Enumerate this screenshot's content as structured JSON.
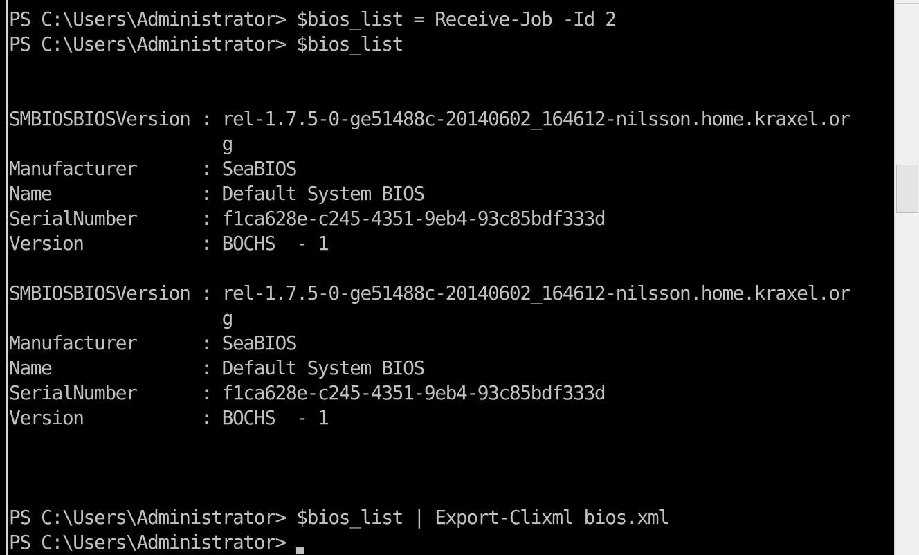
{
  "terminal": {
    "lines": [
      "PS C:\\Users\\Administrator> $bios_list = Receive-Job -Id 2",
      "PS C:\\Users\\Administrator> $bios_list",
      "",
      "",
      "SMBIOSBIOSVersion : rel-1.7.5-0-ge51488c-20140602_164612-nilsson.home.kraxel.or",
      "                    g",
      "Manufacturer      : SeaBIOS",
      "Name              : Default System BIOS",
      "SerialNumber      : f1ca628e-c245-4351-9eb4-93c85bdf333d",
      "Version           : BOCHS  - 1",
      "",
      "SMBIOSBIOSVersion : rel-1.7.5-0-ge51488c-20140602_164612-nilsson.home.kraxel.or",
      "                    g",
      "Manufacturer      : SeaBIOS",
      "Name              : Default System BIOS",
      "SerialNumber      : f1ca628e-c245-4351-9eb4-93c85bdf333d",
      "Version           : BOCHS  - 1",
      "",
      "",
      "",
      "PS C:\\Users\\Administrator> $bios_list | Export-Clixml bios.xml"
    ],
    "prompt_line": "PS C:\\Users\\Administrator> "
  },
  "colors": {
    "background": "#000000",
    "foreground": "#c0c0c0",
    "scrollbar_track": "#f0f0f0",
    "scrollbar_thumb": "#e4e4e4"
  }
}
